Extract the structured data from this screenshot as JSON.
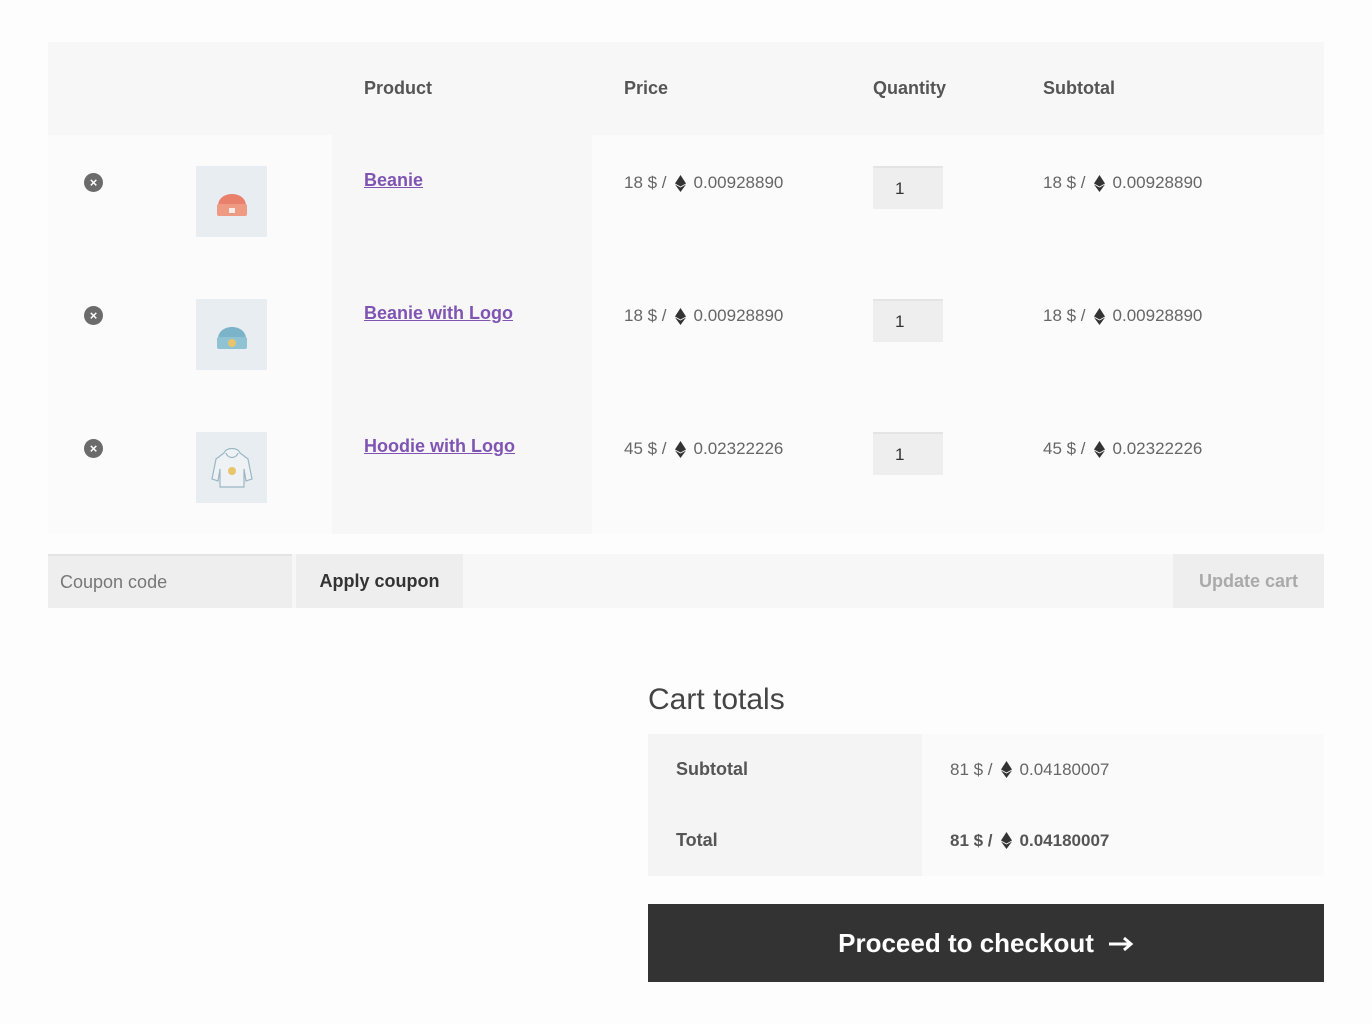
{
  "cart": {
    "headers": {
      "product": "Product",
      "price": "Price",
      "quantity": "Quantity",
      "subtotal": "Subtotal"
    },
    "items": [
      {
        "name": "Beanie",
        "thumb_icon": "beanie-icon",
        "thumb_color": "#e8806b",
        "price_fiat": "18 $ /",
        "price_eth": "0.00928890",
        "quantity": "1",
        "subtotal_fiat": "18 $ /",
        "subtotal_eth": "0.00928890"
      },
      {
        "name": "Beanie with Logo",
        "thumb_icon": "beanie-logo-icon",
        "thumb_color": "#7bb3c8",
        "price_fiat": "18 $ /",
        "price_eth": "0.00928890",
        "quantity": "1",
        "subtotal_fiat": "18 $ /",
        "subtotal_eth": "0.00928890"
      },
      {
        "name": "Hoodie with Logo",
        "thumb_icon": "hoodie-icon",
        "thumb_color": "#a9c9d6",
        "price_fiat": "45 $ /",
        "price_eth": "0.02322226",
        "quantity": "1",
        "subtotal_fiat": "45 $ /",
        "subtotal_eth": "0.02322226"
      }
    ],
    "remove_icon": "close-circle-icon",
    "currency_icon": "ethereum-icon"
  },
  "actions": {
    "coupon_placeholder": "Coupon code",
    "apply_label": "Apply coupon",
    "update_label": "Update cart"
  },
  "totals": {
    "title": "Cart totals",
    "subtotal_label": "Subtotal",
    "subtotal_fiat": "81 $ /",
    "subtotal_eth": "0.04180007",
    "total_label": "Total",
    "total_fiat": "81 $ /",
    "total_eth": "0.04180007"
  },
  "checkout": {
    "label": "Proceed to checkout",
    "icon": "arrow-right-icon"
  },
  "colors": {
    "link": "#7f54b3",
    "checkout_bg": "#333333"
  }
}
